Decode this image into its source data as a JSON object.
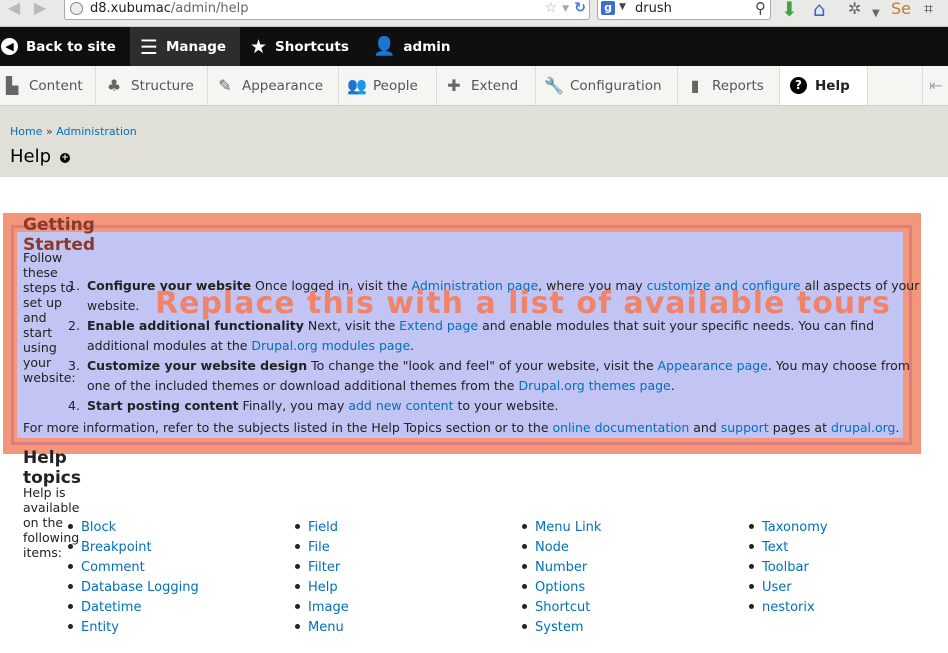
{
  "browser": {
    "url_host": "d8.xubumac",
    "url_path": "/admin/help",
    "search_text": "drush",
    "search_engine_letter": "g"
  },
  "toolbar": {
    "back_label": "Back to site",
    "manage_label": "Manage",
    "shortcuts_label": "Shortcuts",
    "user_label": "admin"
  },
  "tray": {
    "items": [
      "Content",
      "Structure",
      "Appearance",
      "People",
      "Extend",
      "Configuration",
      "Reports",
      "Help"
    ]
  },
  "header": {
    "breadcrumb_home": "Home",
    "breadcrumb_sep": "»",
    "breadcrumb_admin": "Administration",
    "title": "Help"
  },
  "overlay": {
    "text": "Replace this with a list of available tours",
    "colors": {
      "outer": "#f4967a",
      "inner": "#c2c4f4"
    }
  },
  "getting_started": {
    "title": "Getting Started",
    "intro": "Follow these steps to set up and start using your website:",
    "steps": [
      {
        "num": "1.",
        "bold": "Configure your website",
        "t1": " Once logged in, visit the ",
        "l1": "Administration page",
        "t2": ", where you may ",
        "l2": "customize and configure",
        "t3": " all aspects of your website."
      },
      {
        "num": "2.",
        "bold": "Enable additional functionality",
        "t1": " Next, visit the ",
        "l1": "Extend page",
        "t2": " and enable modules that suit your specific needs. You can find additional modules at the ",
        "l2": "Drupal.org modules page",
        "t3": "."
      },
      {
        "num": "3.",
        "bold": "Customize your website design",
        "t1": " To change the \"look and feel\" of your website, visit the ",
        "l1": "Appearance page",
        "t2": ". You may choose from one of the included themes or download additional themes from the ",
        "l2": "Drupal.org themes page",
        "t3": "."
      },
      {
        "num": "4.",
        "bold": "Start posting content",
        "t1": " Finally, you may ",
        "l1": "add new content",
        "t2": " to your website.",
        "l2": "",
        "t3": ""
      }
    ],
    "more_info": {
      "t1": "For more information, refer to the subjects listed in the Help Topics section or to the ",
      "l1": "online documentation",
      "t2": " and ",
      "l2": "support",
      "t3": " pages at ",
      "l3": "drupal.org",
      "t4": "."
    }
  },
  "help_topics": {
    "title": "Help topics",
    "intro": "Help is available on the following items:",
    "columns": [
      [
        "Block",
        "Breakpoint",
        "Comment",
        "Database Logging",
        "Datetime",
        "Entity"
      ],
      [
        "Field",
        "File",
        "Filter",
        "Help",
        "Image",
        "Menu"
      ],
      [
        "Menu Link",
        "Node",
        "Number",
        "Options",
        "Shortcut",
        "System"
      ],
      [
        "Taxonomy",
        "Text",
        "Toolbar",
        "User",
        "nestorix"
      ]
    ]
  }
}
